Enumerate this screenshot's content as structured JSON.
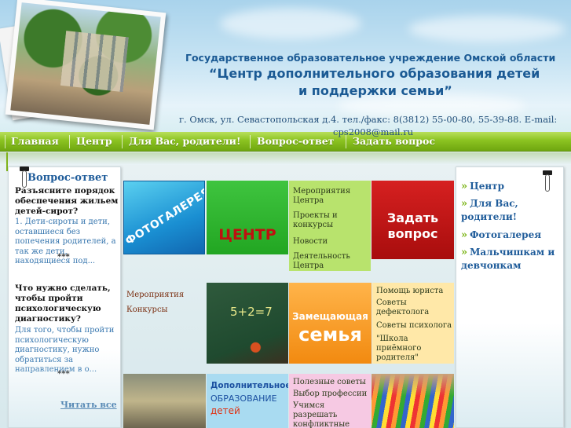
{
  "header": {
    "org_line1": "Государственное образовательное учреждение Омской области",
    "org_line2": "“Центр дополнительного образования детей",
    "org_line3": "и поддержки семьи”",
    "address": "г. Омск, ул. Севастопольская д.4. тел./факс: 8(3812) 55-00-80, 55-39-88. E-mail:",
    "email": "cps2008@mail.ru"
  },
  "nav": {
    "items": [
      "Главная",
      "Центр",
      "Для Вас, родители!",
      "Вопрос-ответ",
      "Задать вопрос"
    ]
  },
  "left_panel": {
    "title": "Вопрос-ответ",
    "entries": [
      {
        "question": "Разъясните порядок обеспечения жильем детей-сирот?",
        "answer": "1. Дети-сироты и дети, оставшиеся без попечения родителей, а так же дети, находящиеся под...",
        "sep": "***"
      },
      {
        "question": "Что нужно сделать, чтобы пройти психологическую диагностику?",
        "answer": "Для того, чтобы пройти психологическую диагностику, нужно обратиться за направлением в о...",
        "sep": "***"
      }
    ],
    "read_all": "Читать все"
  },
  "right_panel": {
    "items": [
      "Центр",
      "Для Вас, родители!",
      "Фотогалерея",
      "Мальчишкам и девчонкам"
    ]
  },
  "tiles": {
    "gallery": "ФОТОГАЛЕРЕЯ",
    "center": "ЦЕНТР",
    "ask": [
      "Задать",
      "вопрос"
    ],
    "center_links": [
      "Мероприятия Центра",
      "Проекты и конкурсы",
      "Новости",
      "Деятельность Центра"
    ],
    "events_links": [
      "Мероприятия",
      "Конкурсы"
    ],
    "chalk_text": "5+2=7",
    "family_l1": "Замещающая",
    "family_l2": "семья",
    "help_links": [
      "Помощь юриста",
      "Советы дефектолога",
      "Советы психолога",
      "\"Школа приёмного родителя\""
    ],
    "dop_l1": "Дополнительное",
    "dop_l2": "ОБРАЗОВАНИЕ",
    "dop_l3": "детей",
    "advice_links": [
      "Полезные советы",
      "Выбор профессии",
      "Учимся разрешать конфликтные ситуации"
    ]
  },
  "colors": {
    "nav_green": "#8bc321",
    "title_blue": "#1b5a94",
    "tile_red": "#c01010",
    "tile_orange": "#f28a10"
  }
}
